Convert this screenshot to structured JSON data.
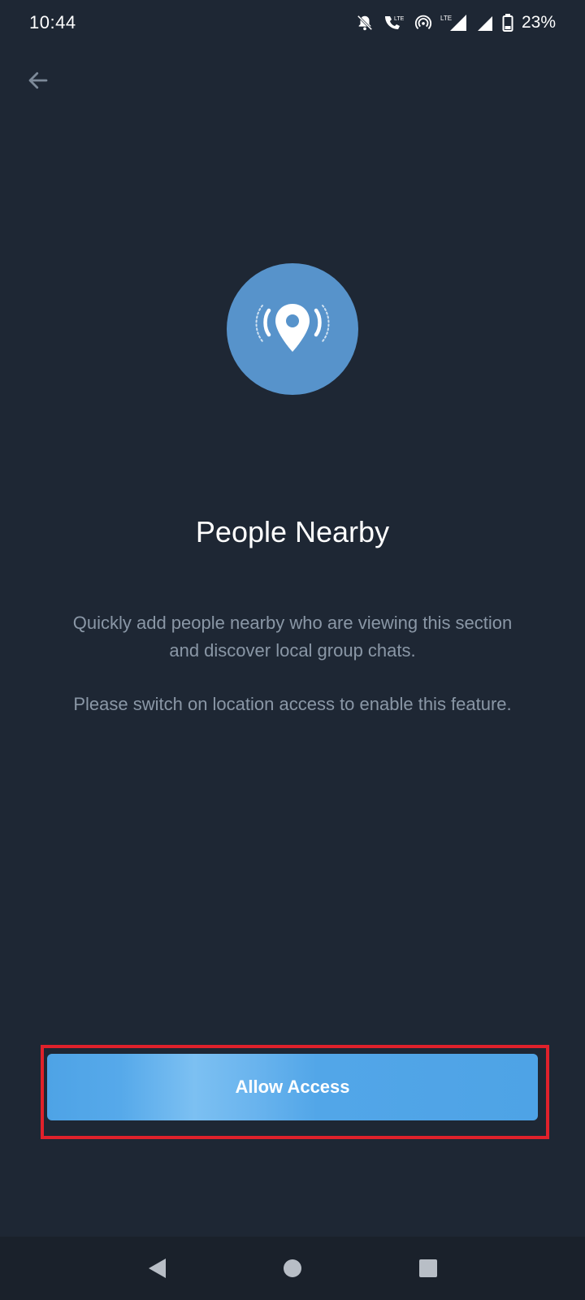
{
  "status_bar": {
    "time": "10:44",
    "network_label_1": "LTE",
    "network_label_2": "LTE",
    "battery": "23%",
    "icons": [
      "bell-off-icon",
      "volte-call-icon",
      "hotspot-icon",
      "signal-icon",
      "signal-icon",
      "battery-icon"
    ]
  },
  "header": {
    "back_icon": "arrow-left-icon"
  },
  "hero": {
    "icon": "location-broadcast-icon",
    "color": "#5793cb"
  },
  "content": {
    "title": "People Nearby",
    "description_line1": "Quickly add people nearby who are viewing this section",
    "description_line2": "and discover local group chats.",
    "hint": "Please switch on location access to enable this feature."
  },
  "action": {
    "allow_label": "Allow Access",
    "button_color": "#4ea3e6",
    "highlight_color": "#e0212b"
  },
  "nav": {
    "icons": [
      "back-triangle-icon",
      "home-circle-icon",
      "recents-square-icon"
    ]
  },
  "colors": {
    "background": "#1e2734",
    "nav_background": "#1a212b",
    "muted_text": "#8a97a6"
  }
}
